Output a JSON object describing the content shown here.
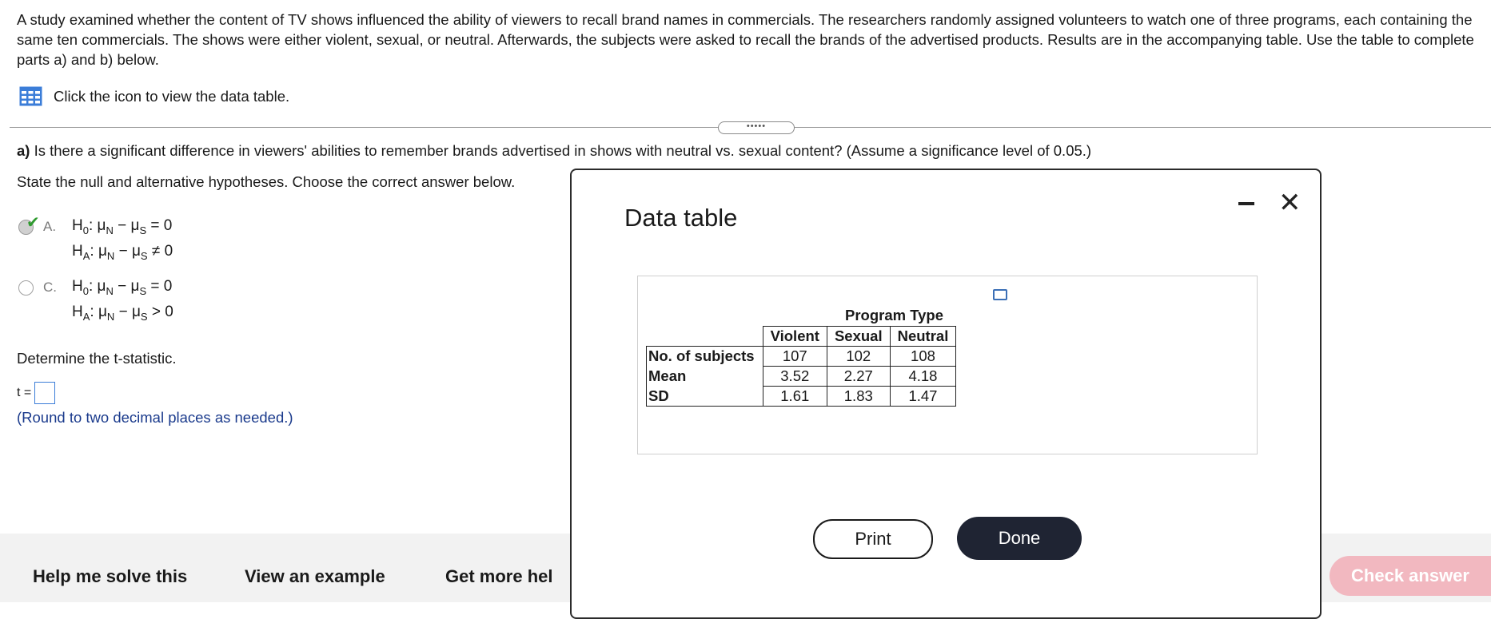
{
  "question": {
    "intro": "A study examined whether the content of TV shows influenced the ability of viewers to recall brand names in commercials. The researchers randomly assigned volunteers to watch one of three programs, each containing the same ten commercials. The shows were either violent, sexual, or neutral. Afterwards, the subjects were asked to recall the brands of the advertised products. Results are in the accompanying table. Use the table to complete parts a) and b) below.",
    "table_link_text": "Click the icon to view the data table.",
    "divider_handle": "•••••",
    "part_a_label": "a)",
    "part_a_text": " Is there a significant difference in viewers' abilities to remember brands advertised in shows with neutral vs. sexual content? (Assume a significance level of 0.05.)",
    "state_hypotheses": "State the null and alternative hypotheses. Choose the correct answer below.",
    "options": [
      {
        "letter": "A.",
        "selected": true,
        "correct": true,
        "h0": {
          "prefix": "H",
          "sub": "0",
          "body": ": μ",
          "s1": "N",
          "mid": " − μ",
          "s2": "S",
          "rel": " = 0"
        },
        "ha": {
          "prefix": "H",
          "sub": "A",
          "body": ": μ",
          "s1": "N",
          "mid": " − μ",
          "s2": "S",
          "rel": " ≠ 0"
        }
      },
      {
        "letter": "C.",
        "selected": false,
        "correct": false,
        "h0": {
          "prefix": "H",
          "sub": "0",
          "body": ": μ",
          "s1": "N",
          "mid": " − μ",
          "s2": "S",
          "rel": " = 0"
        },
        "ha": {
          "prefix": "H",
          "sub": "A",
          "body": ": μ",
          "s1": "N",
          "mid": " − μ",
          "s2": "S",
          "rel": " > 0"
        }
      }
    ],
    "determine_t": "Determine the t-statistic.",
    "t_label": "t =",
    "t_value": "",
    "round_hint": "(Round to two decimal places as needed.)"
  },
  "footer": {
    "help_me_solve": "Help me solve this",
    "view_example": "View an example",
    "get_more_help": "Get more hel",
    "check_answer": "Check answer"
  },
  "modal": {
    "title": "Data table",
    "program_type": "Program Type",
    "columns": [
      "Violent",
      "Sexual",
      "Neutral"
    ],
    "rows": [
      {
        "label": "No. of subjects",
        "values": [
          "107",
          "102",
          "108"
        ]
      },
      {
        "label": "Mean",
        "values": [
          "3.52",
          "2.27",
          "4.18"
        ]
      },
      {
        "label": "SD",
        "values": [
          "1.61",
          "1.83",
          "1.47"
        ]
      }
    ],
    "print_label": "Print",
    "done_label": "Done"
  },
  "colors": {
    "accent_blue": "#3b7dd8",
    "done_button": "#1f2433",
    "check_answer_disabled": "#f2b8c0",
    "correct_check": "#2e9a2e"
  },
  "icons": [
    "table-icon",
    "checkmark-icon",
    "minimize-icon",
    "close-icon",
    "popout-icon"
  ]
}
